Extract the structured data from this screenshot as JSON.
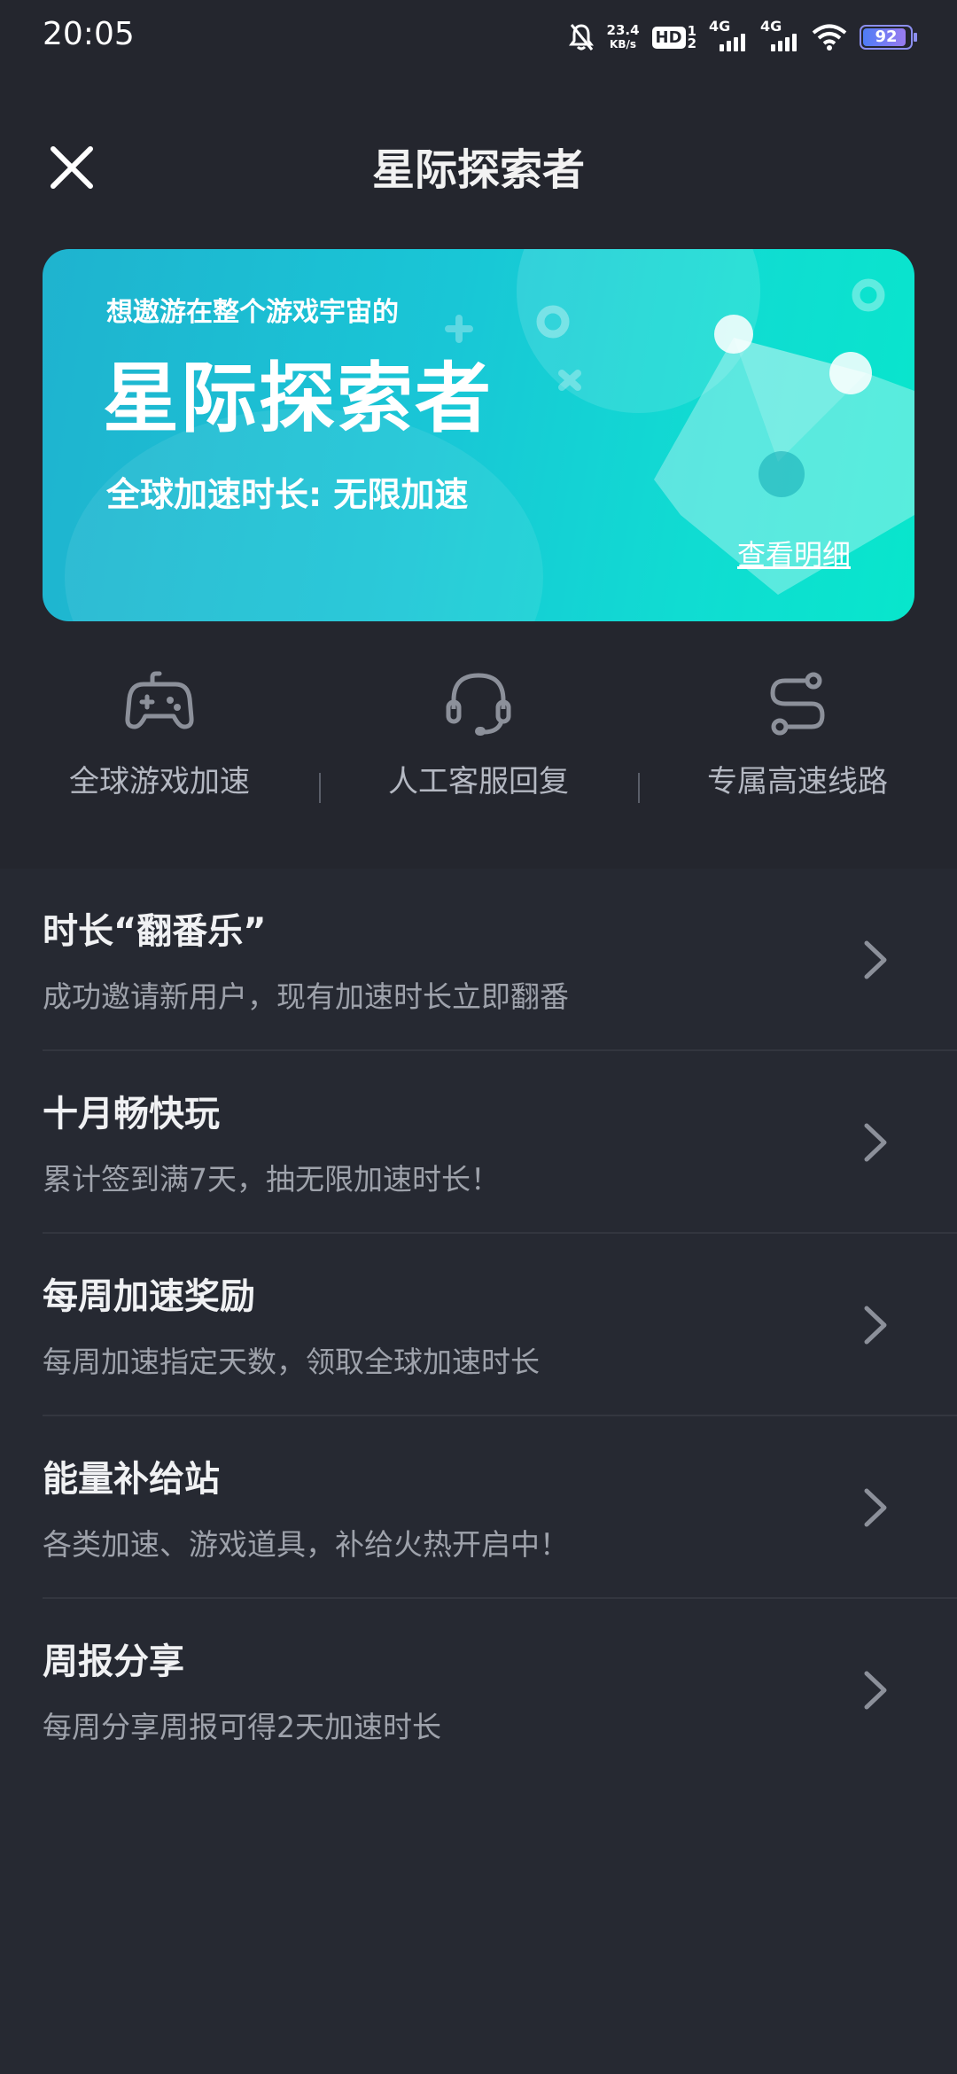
{
  "status_bar": {
    "time": "20:05",
    "net_speed_value": "23.4",
    "net_speed_unit": "KB/s",
    "hd_label": "HD",
    "hd_sim_top": "1",
    "hd_sim_bottom": "2",
    "sim1_label": "4G",
    "sim2_label": "4G",
    "battery": "92"
  },
  "header": {
    "title": "星际探索者"
  },
  "banner": {
    "subtitle": "想遨游在整个游戏宇宙的",
    "title": "星际探索者",
    "duration": "全球加速时长: 无限加速",
    "detail_link": "查看明细"
  },
  "features": [
    {
      "label": "全球游戏加速",
      "icon": "gamepad-icon"
    },
    {
      "label": "人工客服回复",
      "icon": "headset-icon"
    },
    {
      "label": "专属高速线路",
      "icon": "route-icon"
    }
  ],
  "list": [
    {
      "title": "时长“翻番乐”",
      "desc": "成功邀请新用户，现有加速时长立即翻番"
    },
    {
      "title": "十月畅快玩",
      "desc": "累计签到满7天，抽无限加速时长！"
    },
    {
      "title": "每周加速奖励",
      "desc": "每周加速指定天数，领取全球加速时长"
    },
    {
      "title": "能量补给站",
      "desc": "各类加速、游戏道具，补给火热开启中！"
    },
    {
      "title": "周报分享",
      "desc": "每周分享周报可得2天加速时长"
    }
  ],
  "colors": {
    "background": "#262932",
    "header_background": "#24262e",
    "banner_start": "#1fb3cf",
    "banner_end": "#08e6cc",
    "muted_text": "#9ea2ab"
  }
}
